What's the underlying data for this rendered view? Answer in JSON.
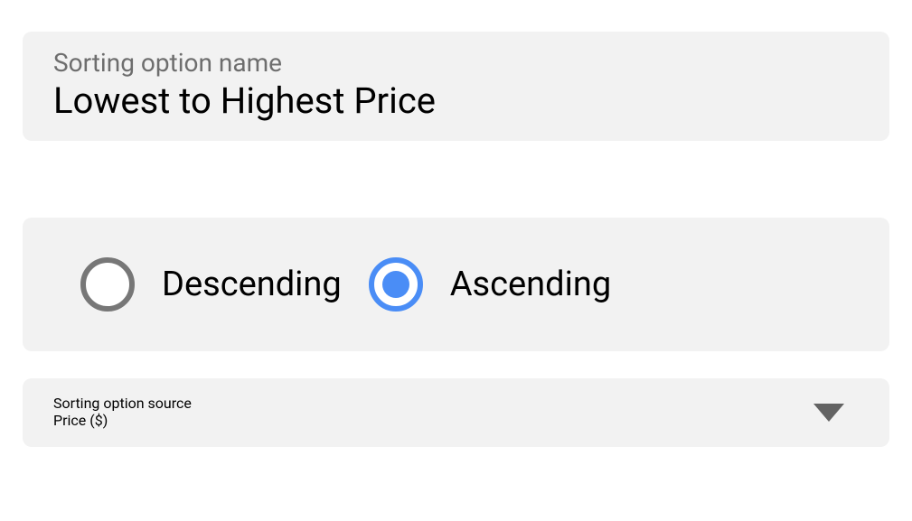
{
  "sortingName": {
    "label": "Sorting option name",
    "value": "Lowest to Highest Price"
  },
  "order": {
    "options": [
      {
        "label": "Descending",
        "selected": false
      },
      {
        "label": "Ascending",
        "selected": true
      }
    ]
  },
  "sortingSource": {
    "label": "Sorting option source",
    "value": "Price ($)"
  }
}
